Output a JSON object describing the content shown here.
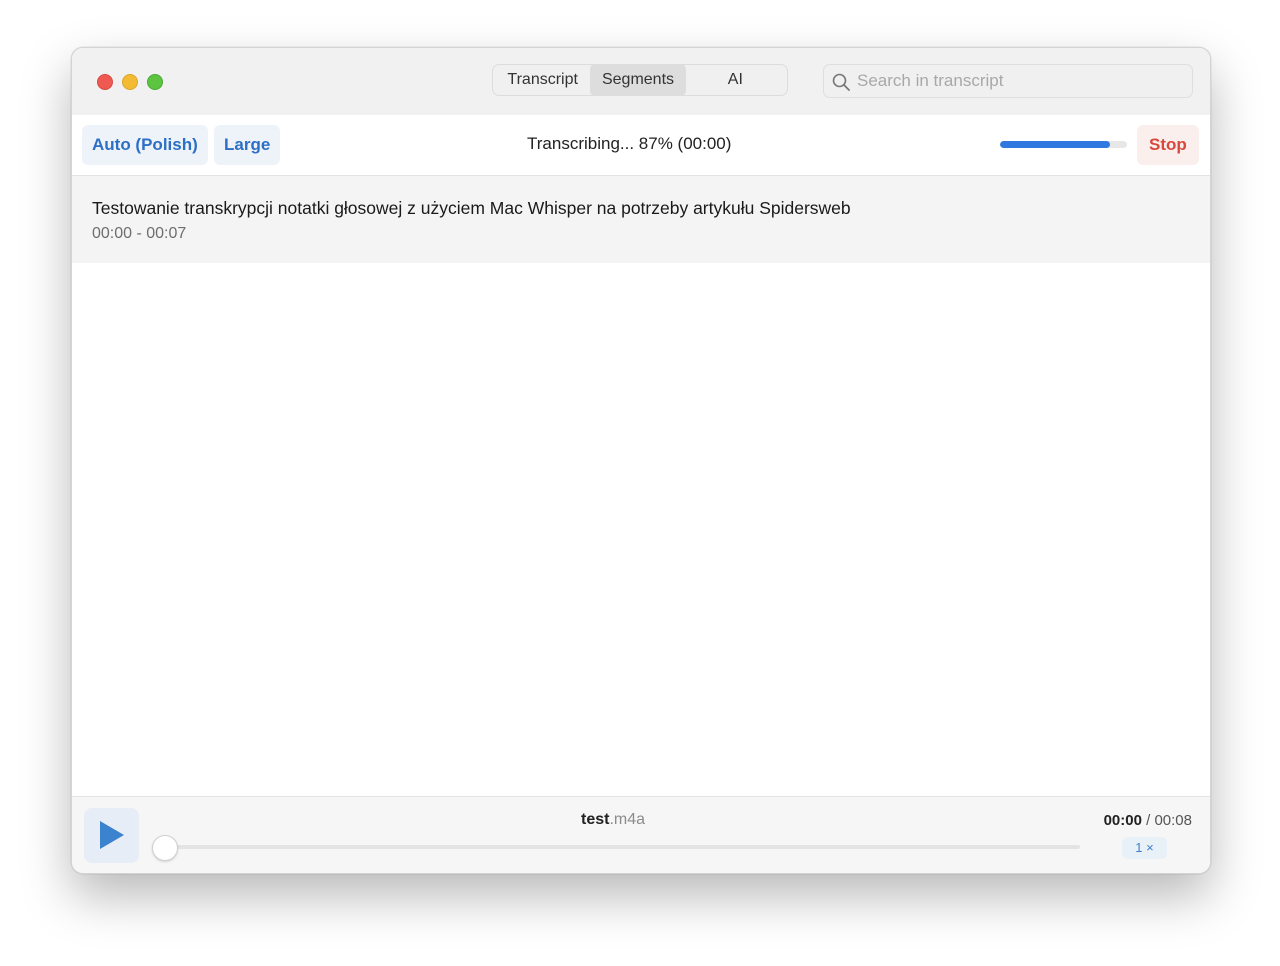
{
  "window": {
    "tabs": [
      {
        "label": "Transcript",
        "selected": false
      },
      {
        "label": "Segments",
        "selected": true
      },
      {
        "label": "AI",
        "selected": false
      }
    ],
    "search": {
      "placeholder": "Search in transcript",
      "value": ""
    }
  },
  "toolbar": {
    "language_label": "Auto (Polish)",
    "model_label": "Large",
    "status_text": "Transcribing... 87% (00:00)",
    "progress_fraction": 0.87,
    "stop_label": "Stop",
    "accent_color": "#2f78e0",
    "stop_color": "#d8493c"
  },
  "segments": [
    {
      "text": "Testowanie transkrypcji notatki głosowej z użyciem Mac Whisper na potrzeby artykułu Spidersweb",
      "time_range": "00:00 - 00:07"
    }
  ],
  "player": {
    "file_base": "test",
    "file_ext": ".m4a",
    "current_time": "00:00",
    "separator": " / ",
    "total_time": "00:08",
    "playback_fraction": 0.0,
    "speed_label": "1 ×",
    "play_icon": "play-icon"
  }
}
